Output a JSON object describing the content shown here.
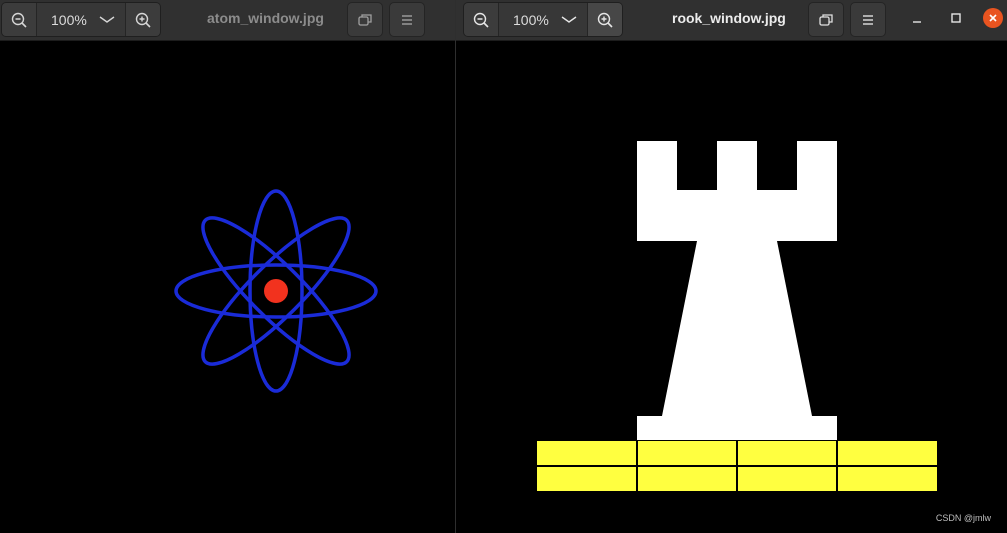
{
  "left_window": {
    "title": "atom_window.jpg",
    "zoom": {
      "level": "100%"
    },
    "icons": [
      "zoom-out-icon",
      "chevron-down-icon",
      "zoom-in-icon",
      "restore-view-icon",
      "menu-icon"
    ],
    "image": {
      "description_icon": "atom-icon",
      "colors": {
        "orbits": "#1a2bd8",
        "nucleus": "#f2321e",
        "background": "#000000"
      }
    }
  },
  "right_window": {
    "title": "rook_window.jpg",
    "zoom": {
      "level": "100%"
    },
    "icons": [
      "zoom-out-icon",
      "chevron-down-icon",
      "zoom-in-icon",
      "restore-view-icon",
      "menu-icon",
      "minimize-icon",
      "maximize-icon",
      "close-icon"
    ],
    "image": {
      "description_icon": "rook-icon",
      "colors": {
        "rook": "#ffffff",
        "base_bricks": "#ffff40",
        "background": "#000000"
      }
    }
  },
  "watermark": "CSDN @jmlw",
  "accent_colors": {
    "close": "#e95420",
    "headerbar": "#303030"
  }
}
